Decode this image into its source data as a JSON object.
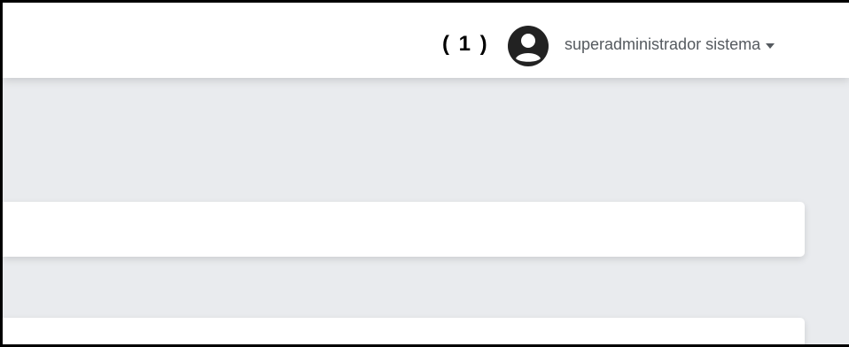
{
  "header": {
    "annotation_label": "( 1 )",
    "user_name": "superadministrador sistema",
    "avatar_icon": "user-circle-icon",
    "caret_icon": "caret-down-icon"
  },
  "colors": {
    "background": "#e9ebee",
    "card": "#ffffff",
    "text_muted": "#555a5f",
    "avatar": "#222222"
  }
}
